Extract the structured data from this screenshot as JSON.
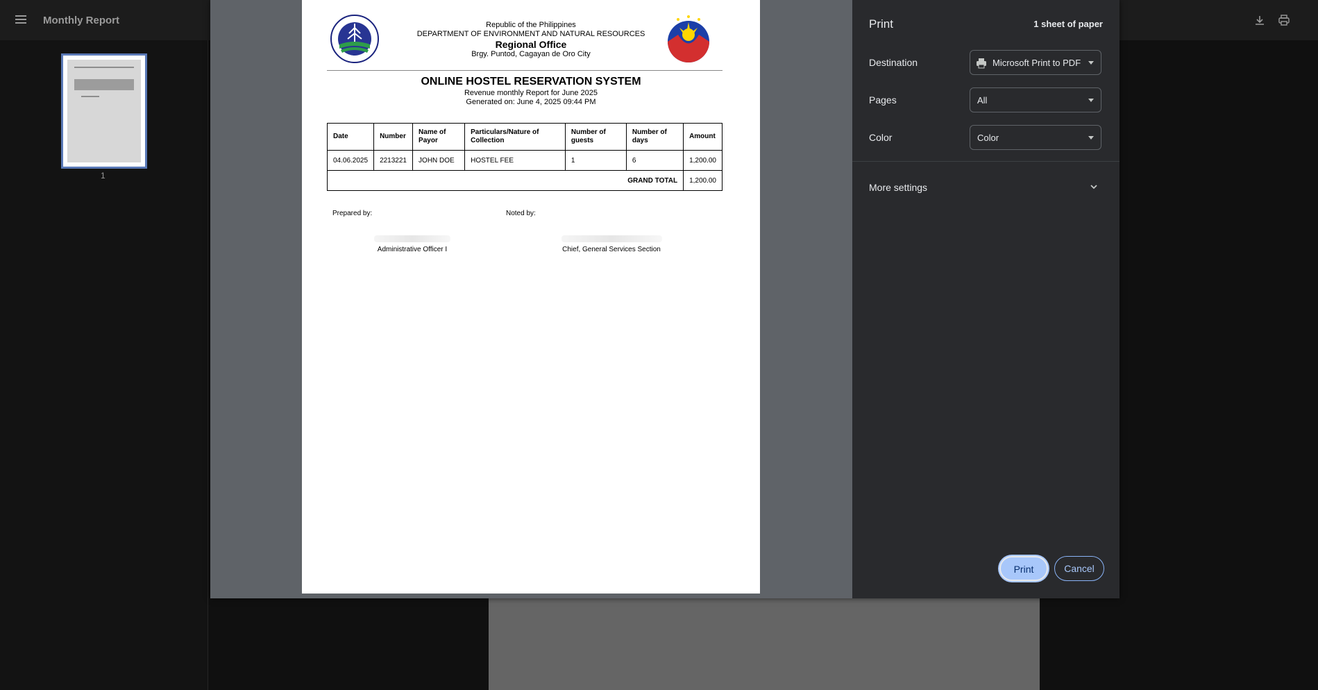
{
  "viewer": {
    "title": "Monthly Report",
    "page_number": "1",
    "icons": [
      "menu-icon",
      "download-icon",
      "print-icon"
    ]
  },
  "report": {
    "header": {
      "line1": "Republic of the Philippines",
      "line2": "DEPARTMENT OF ENVIRONMENT AND NATURAL RESOURCES",
      "line3": "Regional Office",
      "line4": "Brgy. Puntod, Cagayan de Oro City"
    },
    "seal_left_text": "DEPARTMENT OF ENVIRONMENT AND NATURAL RESOURCES · REGION 10",
    "title": "ONLINE HOSTEL RESERVATION SYSTEM",
    "subtitle": "Revenue monthly Report for June 2025",
    "generated": "Generated on: June 4, 2025 09:44 PM",
    "columns": [
      "Date",
      "Number",
      "Name of Payor",
      "Particulars/Nature of Collection",
      "Number of guests",
      "Number of days",
      "Amount"
    ],
    "rows": [
      [
        "04.06.2025",
        "2213221",
        "JOHN DOE",
        "HOSTEL FEE",
        "1",
        "6",
        "1,200.00"
      ]
    ],
    "grand_total_label": "GRAND TOTAL",
    "grand_total": "1,200.00",
    "prepared_by_label": "Prepared by:",
    "noted_by_label": "Noted by:",
    "prepared_title": "Administrative Officer I",
    "noted_title": "Chief, General Services Section"
  },
  "print": {
    "title": "Print",
    "sheets": "1 sheet of paper",
    "destination_label": "Destination",
    "destination_value": "Microsoft Print to PDF",
    "pages_label": "Pages",
    "pages_value": "All",
    "color_label": "Color",
    "color_value": "Color",
    "more_settings": "More settings",
    "print_button": "Print",
    "cancel_button": "Cancel"
  },
  "colors": {
    "dialog_bg": "#292a2d",
    "preview_bg": "#5f6368",
    "accent": "#a8c7fa"
  }
}
